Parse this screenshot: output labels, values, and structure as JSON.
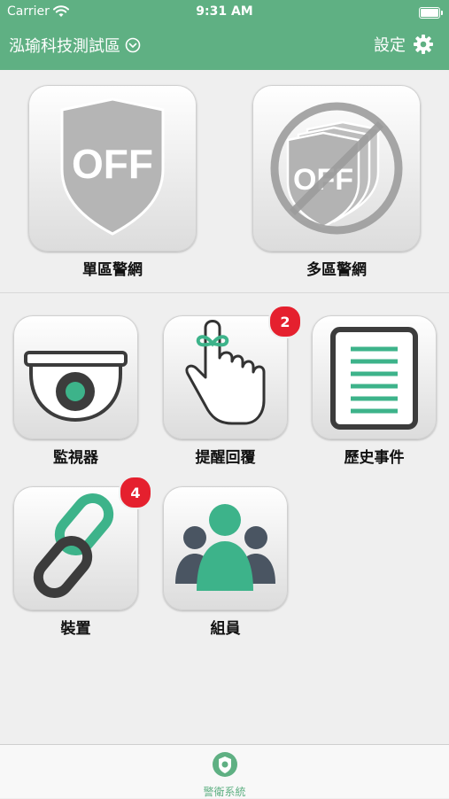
{
  "status_bar": {
    "carrier": "Carrier",
    "time": "9:31 AM"
  },
  "nav": {
    "site_name": "泓瑜科技測試區",
    "settings_label": "設定"
  },
  "top_tiles": [
    {
      "label": "單區警網",
      "icon": "shield-off-icon",
      "icon_text": "OFF"
    },
    {
      "label": "多區警網",
      "icon": "multi-shield-off-prohibited-icon",
      "icon_text": "OFF"
    }
  ],
  "tiles": [
    {
      "label": "監視器",
      "icon": "camera-icon"
    },
    {
      "label": "提醒回覆",
      "icon": "reminder-hand-icon",
      "badge": "2"
    },
    {
      "label": "歷史事件",
      "icon": "document-list-icon"
    },
    {
      "label": "裝置",
      "icon": "chain-link-icon",
      "badge": "4"
    },
    {
      "label": "組員",
      "icon": "group-members-icon"
    }
  ],
  "tab_bar": {
    "tabs": [
      {
        "label": "警衛系統",
        "icon": "guard-system-icon"
      }
    ]
  },
  "colors": {
    "brand": "#5fb083",
    "badge": "#e5202e",
    "icon_dark": "#3c3c3c",
    "icon_grey": "#b4b4b4"
  }
}
